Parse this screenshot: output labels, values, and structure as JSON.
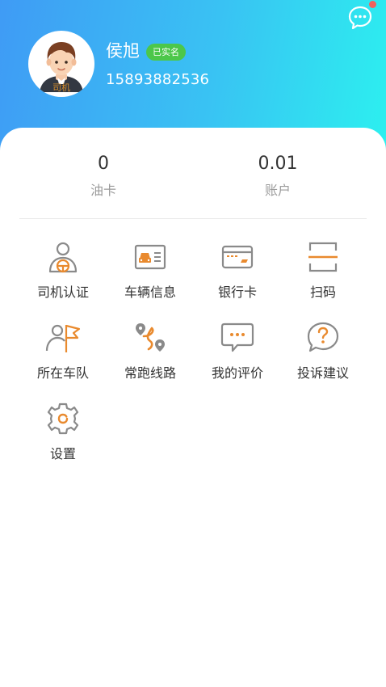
{
  "profile": {
    "name": "侯旭",
    "verified_badge": "已实名",
    "phone": "15893882536",
    "role_tag": "司机"
  },
  "stats": [
    {
      "value": "0",
      "label": "油卡"
    },
    {
      "value": "0.01",
      "label": "账户"
    }
  ],
  "menu": [
    {
      "label": "司机认证",
      "icon": "driver-cert-icon"
    },
    {
      "label": "车辆信息",
      "icon": "vehicle-info-icon"
    },
    {
      "label": "银行卡",
      "icon": "bank-card-icon"
    },
    {
      "label": "扫码",
      "icon": "scan-icon"
    },
    {
      "label": "所在车队",
      "icon": "fleet-flag-icon"
    },
    {
      "label": "常跑线路",
      "icon": "route-icon"
    },
    {
      "label": "我的评价",
      "icon": "review-chat-icon"
    },
    {
      "label": "投诉建议",
      "icon": "question-bubble-icon"
    },
    {
      "label": "设置",
      "icon": "settings-gear-icon"
    }
  ],
  "colors": {
    "header_start": "#3f9bf5",
    "header_end": "#2cf0ef",
    "accent_orange": "#e98a2e",
    "icon_gray": "#8a8a8a",
    "badge_green": "#4cc74a",
    "notification_dot": "#f2605d"
  }
}
